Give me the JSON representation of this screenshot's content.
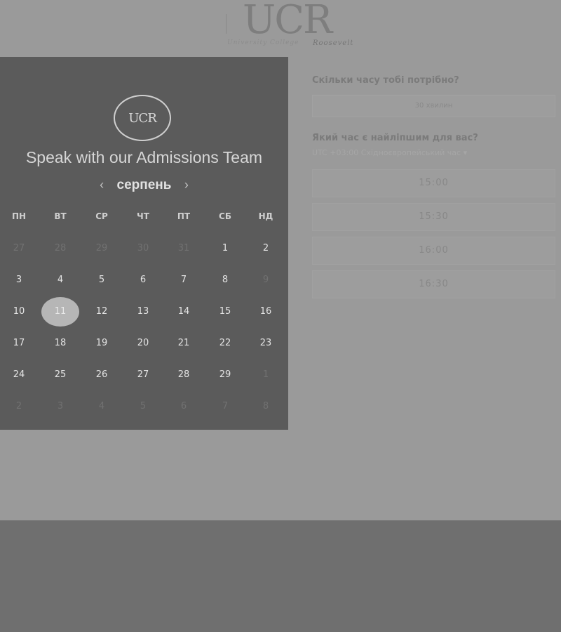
{
  "logo": {
    "text": "UCR",
    "tagline_left": "University College",
    "tagline_right": "Roosevelt"
  },
  "panel": {
    "badge_text": "UCR",
    "title": "Speak with our Admissions Team",
    "month": "серпень",
    "prev_label": "‹",
    "next_label": "›",
    "weekdays": [
      "ПН",
      "ВТ",
      "СР",
      "ЧТ",
      "ПТ",
      "СБ",
      "НД"
    ],
    "weeks": [
      [
        "27",
        "28",
        "29",
        "30",
        "31",
        "1",
        "2"
      ],
      [
        "3",
        "4",
        "5",
        "6",
        "7",
        "8",
        "9"
      ],
      [
        "10",
        "11",
        "12",
        "13",
        "14",
        "15",
        "16"
      ],
      [
        "17",
        "18",
        "19",
        "20",
        "21",
        "22",
        "23"
      ],
      [
        "24",
        "25",
        "26",
        "27",
        "28",
        "29",
        "1"
      ],
      [
        "2",
        "3",
        "4",
        "5",
        "6",
        "7",
        "8"
      ]
    ],
    "selected_day": "11"
  },
  "right": {
    "duration_question": "Скільки часу тобі потрібно?",
    "duration_value": "30 хвилин",
    "time_question": "Який час є найліпшим для вас?",
    "timezone_text": "UTC +03:00 Східноєвропейський час ▾",
    "slots": [
      "15:00",
      "15:30",
      "16:00",
      "16:30"
    ]
  }
}
